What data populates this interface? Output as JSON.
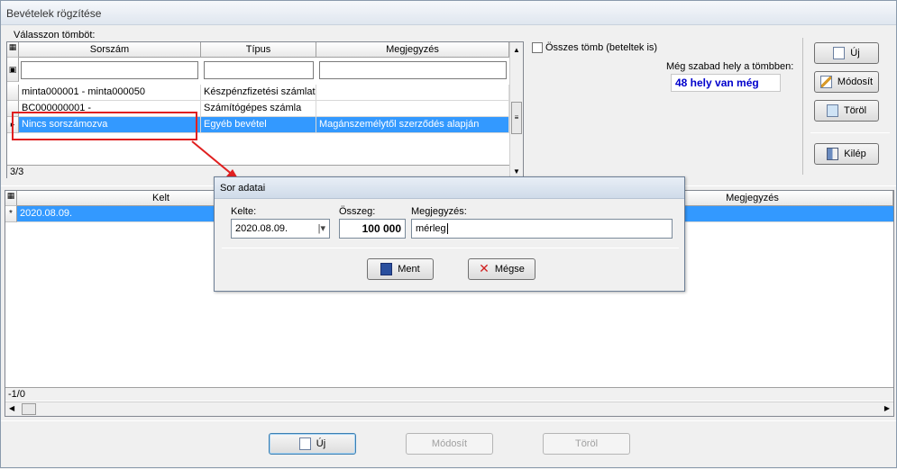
{
  "window": {
    "title": "Bevételek rögzítése"
  },
  "top": {
    "select_label": "Válasszon tömböt:",
    "columns": [
      "Sorszám",
      "Típus",
      "Megjegyzés"
    ],
    "rows": [
      {
        "sorszam": "minta000001 - minta000050",
        "tipus": "Készpénzfizetési számlat...",
        "megj": ""
      },
      {
        "sorszam": "BC000000001 -",
        "tipus": "Számítógépes számla",
        "megj": ""
      },
      {
        "sorszam": "Nincs sorszámozva",
        "tipus": "Egyéb bevétel",
        "megj": "Magánszemélytől szerződés alapján"
      }
    ],
    "counter": "3/3"
  },
  "options": {
    "all_blocks_label": "Összes tömb (beteltek is)",
    "free_space_label": "Még szabad hely a tömbben:",
    "free_space_value": "48 hely van még"
  },
  "side_buttons": {
    "new": "Új",
    "modify": "Módosít",
    "delete": "Töröl",
    "exit": "Kilép"
  },
  "bottom": {
    "columns": [
      "Kelt",
      "Megjegyzés"
    ],
    "row": {
      "kelt": "2020.08.09."
    },
    "new_row_marker": "*",
    "counter": "-1/0"
  },
  "dialog": {
    "title": "Sor adatai",
    "kelte_label": "Kelte:",
    "kelte_value": "2020.08.09.",
    "osszeg_label": "Összeg:",
    "osszeg_value": "100 000",
    "megj_label": "Megjegyzés:",
    "megj_value": "mérleg",
    "ok": "Ment",
    "cancel": "Mégse"
  },
  "bottom_buttons": {
    "new": "Új",
    "modify": "Módosít",
    "delete": "Töröl"
  },
  "colors": {
    "selection": "#3399ff",
    "free_space_text": "#0000cc",
    "annotation": "#e02020"
  }
}
